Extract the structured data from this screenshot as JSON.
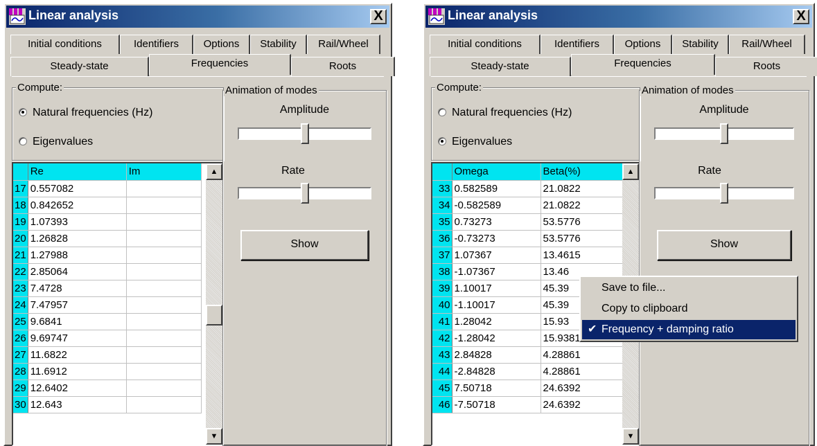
{
  "accent": "#0a246a",
  "grid_header_color": "#00e4f0",
  "windows": [
    {
      "title": "Linear analysis",
      "close_label": "X",
      "tabs_row1": [
        "Initial conditions",
        "Identifiers",
        "Options",
        "Stability",
        "Rail/Wheel"
      ],
      "tabs_row2": [
        "Steady-state",
        "Frequencies",
        "Roots"
      ],
      "selected_tab": "Frequencies",
      "compute_label": "Compute:",
      "radio_natural": "Natural frequencies (Hz)",
      "radio_eigen": "Eigenvalues",
      "selected_radio": "natural",
      "grid": {
        "columns": [
          "Re",
          "Im"
        ],
        "rows": [
          {
            "n": "17",
            "a": "0.557082",
            "b": ""
          },
          {
            "n": "18",
            "a": "0.842652",
            "b": ""
          },
          {
            "n": "19",
            "a": "1.07393",
            "b": ""
          },
          {
            "n": "20",
            "a": "1.26828",
            "b": ""
          },
          {
            "n": "21",
            "a": "1.27988",
            "b": ""
          },
          {
            "n": "22",
            "a": "2.85064",
            "b": ""
          },
          {
            "n": "23",
            "a": "7.4728",
            "b": ""
          },
          {
            "n": "24",
            "a": "7.47957",
            "b": ""
          },
          {
            "n": "25",
            "a": "9.6841",
            "b": ""
          },
          {
            "n": "26",
            "a": "9.69747",
            "b": ""
          },
          {
            "n": "27",
            "a": "11.6822",
            "b": ""
          },
          {
            "n": "28",
            "a": "11.6912",
            "b": ""
          },
          {
            "n": "29",
            "a": "12.6402",
            "b": ""
          },
          {
            "n": "30",
            "a": "12.643",
            "b": ""
          }
        ]
      },
      "animation_label": "Animation of modes",
      "amplitude_label": "Amplitude",
      "rate_label": "Rate",
      "show_label": "Show",
      "amplitude_level": 0.5,
      "rate_level": 0.5,
      "scroll_position": 0.55
    },
    {
      "title": "Linear analysis",
      "close_label": "X",
      "tabs_row1": [
        "Initial conditions",
        "Identifiers",
        "Options",
        "Stability",
        "Rail/Wheel"
      ],
      "tabs_row2": [
        "Steady-state",
        "Frequencies",
        "Roots"
      ],
      "selected_tab": "Frequencies",
      "compute_label": "Compute:",
      "radio_natural": "Natural frequencies (Hz)",
      "radio_eigen": "Eigenvalues",
      "selected_radio": "eigen",
      "grid": {
        "columns": [
          "Omega",
          "Beta(%)"
        ],
        "rows": [
          {
            "n": "33",
            "a": "0.582589",
            "b": "21.0822"
          },
          {
            "n": "34",
            "a": "-0.582589",
            "b": "21.0822"
          },
          {
            "n": "35",
            "a": "0.73273",
            "b": "53.5776"
          },
          {
            "n": "36",
            "a": "-0.73273",
            "b": "53.5776"
          },
          {
            "n": "37",
            "a": "1.07367",
            "b": "13.4615"
          },
          {
            "n": "38",
            "a": "-1.07367",
            "b": "13.46"
          },
          {
            "n": "39",
            "a": "1.10017",
            "b": "45.39"
          },
          {
            "n": "40",
            "a": "-1.10017",
            "b": "45.39"
          },
          {
            "n": "41",
            "a": "1.28042",
            "b": "15.93"
          },
          {
            "n": "42",
            "a": "-1.28042",
            "b": "15.9381"
          },
          {
            "n": "43",
            "a": "2.84828",
            "b": "4.28861"
          },
          {
            "n": "44",
            "a": "-2.84828",
            "b": "4.28861"
          },
          {
            "n": "45",
            "a": "7.50718",
            "b": "24.6392"
          },
          {
            "n": "46",
            "a": "-7.50718",
            "b": "24.6392"
          }
        ]
      },
      "animation_label": "Animation of modes",
      "amplitude_label": "Amplitude",
      "rate_label": "Rate",
      "show_label": "Show",
      "amplitude_level": 0.5,
      "rate_level": 0.5,
      "scroll_position": 0.45
    }
  ],
  "context_menu": {
    "items": [
      {
        "label": "Save to file...",
        "checked": false
      },
      {
        "label": "Copy to clipboard",
        "checked": false
      },
      {
        "label": "Frequency + damping ratio",
        "checked": true
      }
    ],
    "check_glyph": "✔"
  }
}
